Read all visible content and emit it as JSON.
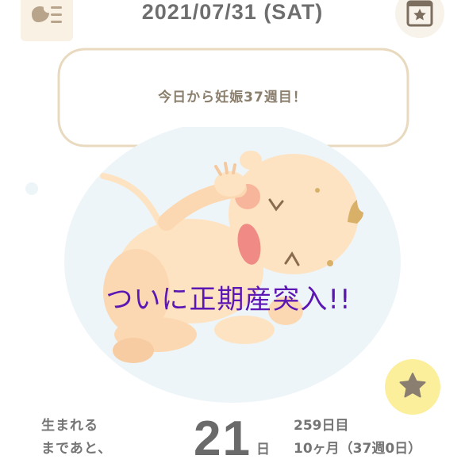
{
  "header": {
    "date": "2021/07/31 (SAT)",
    "menu_icon": "menu-list-icon",
    "calendar_icon": "calendar-star-icon"
  },
  "bubble": {
    "message": "今日から妊娠37週目！"
  },
  "overlay": {
    "caption": "ついに正期産突入!!"
  },
  "favorite": {
    "icon": "star-icon"
  },
  "countdown": {
    "label_line1": "生まれる",
    "label_line2": "まであと、",
    "days_remaining": "21",
    "days_unit": "日",
    "elapsed_days": "259日目",
    "pregnancy_months_weeks": "10ヶ月（37週0日）"
  },
  "colors": {
    "caption": "#5b16b4",
    "favorite_bg": "#fbef9c",
    "bubble_border": "#e8d9bf",
    "baby_skin": "#fde3c2"
  }
}
